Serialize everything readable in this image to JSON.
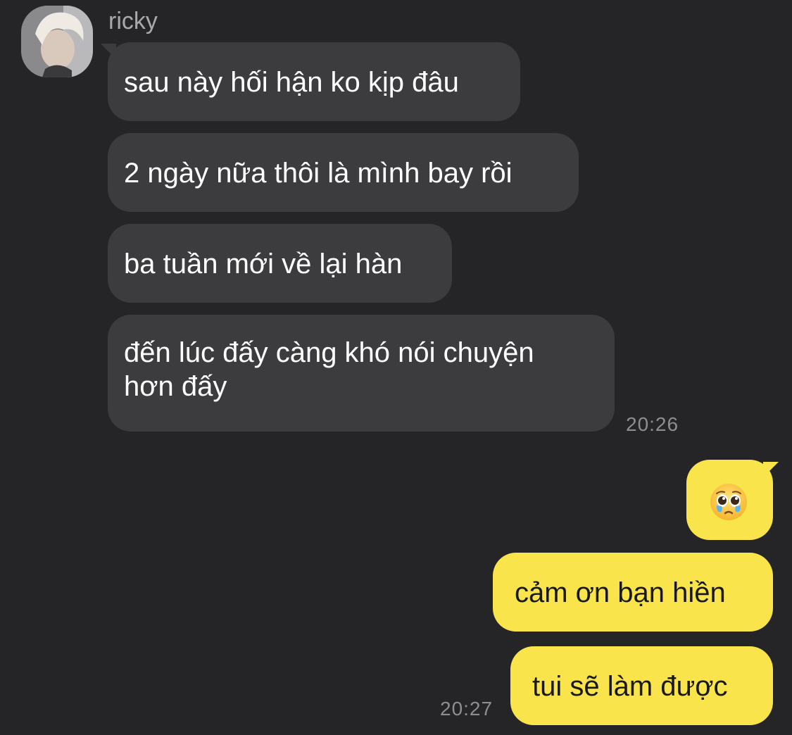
{
  "chat": {
    "incoming": {
      "sender_name": "ricky",
      "messages": [
        "sau này hối hận ko kịp đâu",
        "2 ngày nữa thôi là mình bay rồi",
        "ba tuần mới về lại hàn",
        "đến lúc đấy càng khó nói chuyện",
        "hơn đấy"
      ],
      "time": "20:26"
    },
    "outgoing": {
      "messages": [
        "cảm ơn bạn hiền",
        "tui sẽ làm được"
      ],
      "emoji": "pleading-face-with-tears",
      "time": "20:27"
    }
  },
  "colors": {
    "background": "#252527",
    "incoming_bubble": "#3c3c3e",
    "outgoing_bubble": "#f9e54b",
    "timestamp": "#8d8d92"
  }
}
